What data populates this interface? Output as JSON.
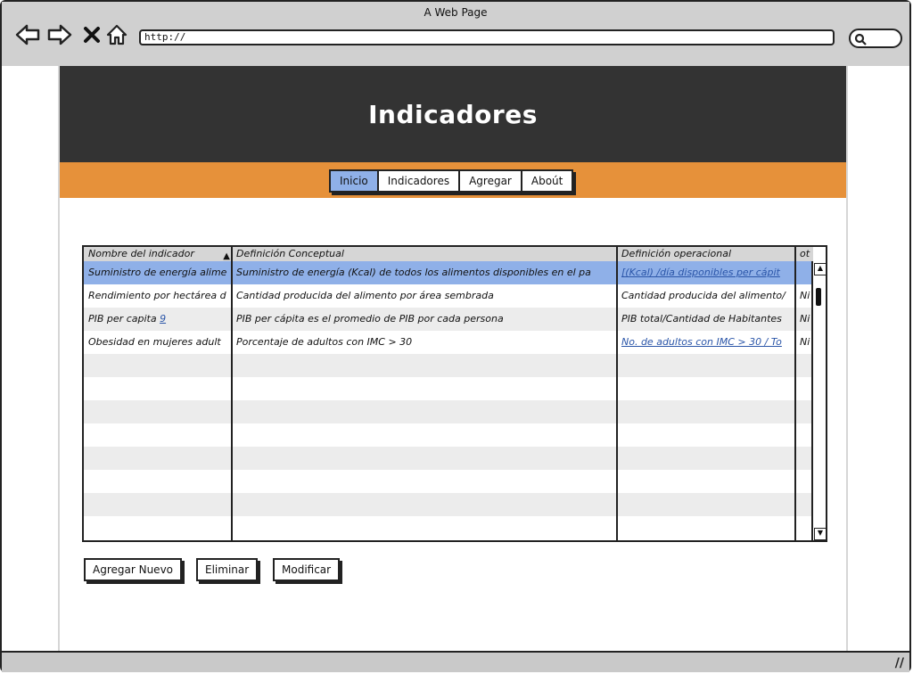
{
  "window": {
    "title": "A Web Page"
  },
  "address_bar": {
    "url": "http://"
  },
  "page": {
    "title": "Indicadores",
    "nav": [
      {
        "label": "Inicio",
        "active": true
      },
      {
        "label": "Indicadores",
        "active": false
      },
      {
        "label": "Agregar",
        "active": false
      },
      {
        "label": "Aboút",
        "active": false
      }
    ]
  },
  "grid": {
    "columns": [
      "Nombre del indicador",
      "Definición Conceptual",
      "Definición operacional",
      "ot"
    ],
    "sort_indicator": "▲",
    "rows": [
      [
        "Suministro de energía alime",
        "Suministro de energía (Kcal) de todos los alimentos disponibles en el pa",
        "[(Kcal) /día disponibles per cápit",
        ""
      ],
      [
        "Rendimiento por hectárea d",
        "Cantidad producida del alimento por área sembrada",
        "Cantidad producida del alimento/",
        "Ni"
      ],
      [
        "PIB per capita",
        "PIB per cápita es el promedio de PIB por cada persona",
        "PIB total/Cantidad de Habitantes",
        "Ni"
      ],
      [
        "Obesidad en mujeres adult",
        "Porcentaje de adultos con IMC > 30",
        "No. de adultos con IMC > 30 / To",
        "Ni"
      ]
    ],
    "row1_number_link": "9",
    "empty_rows": 8
  },
  "actions": {
    "add_label": "Agregar Nuevo",
    "delete_label": "Eliminar",
    "modify_label": "Modificar"
  },
  "colors": {
    "header_bg": "#333333",
    "accent_orange": "#e6913a",
    "selection_blue": "#8fb0e8",
    "link_blue": "#2a55a8"
  }
}
